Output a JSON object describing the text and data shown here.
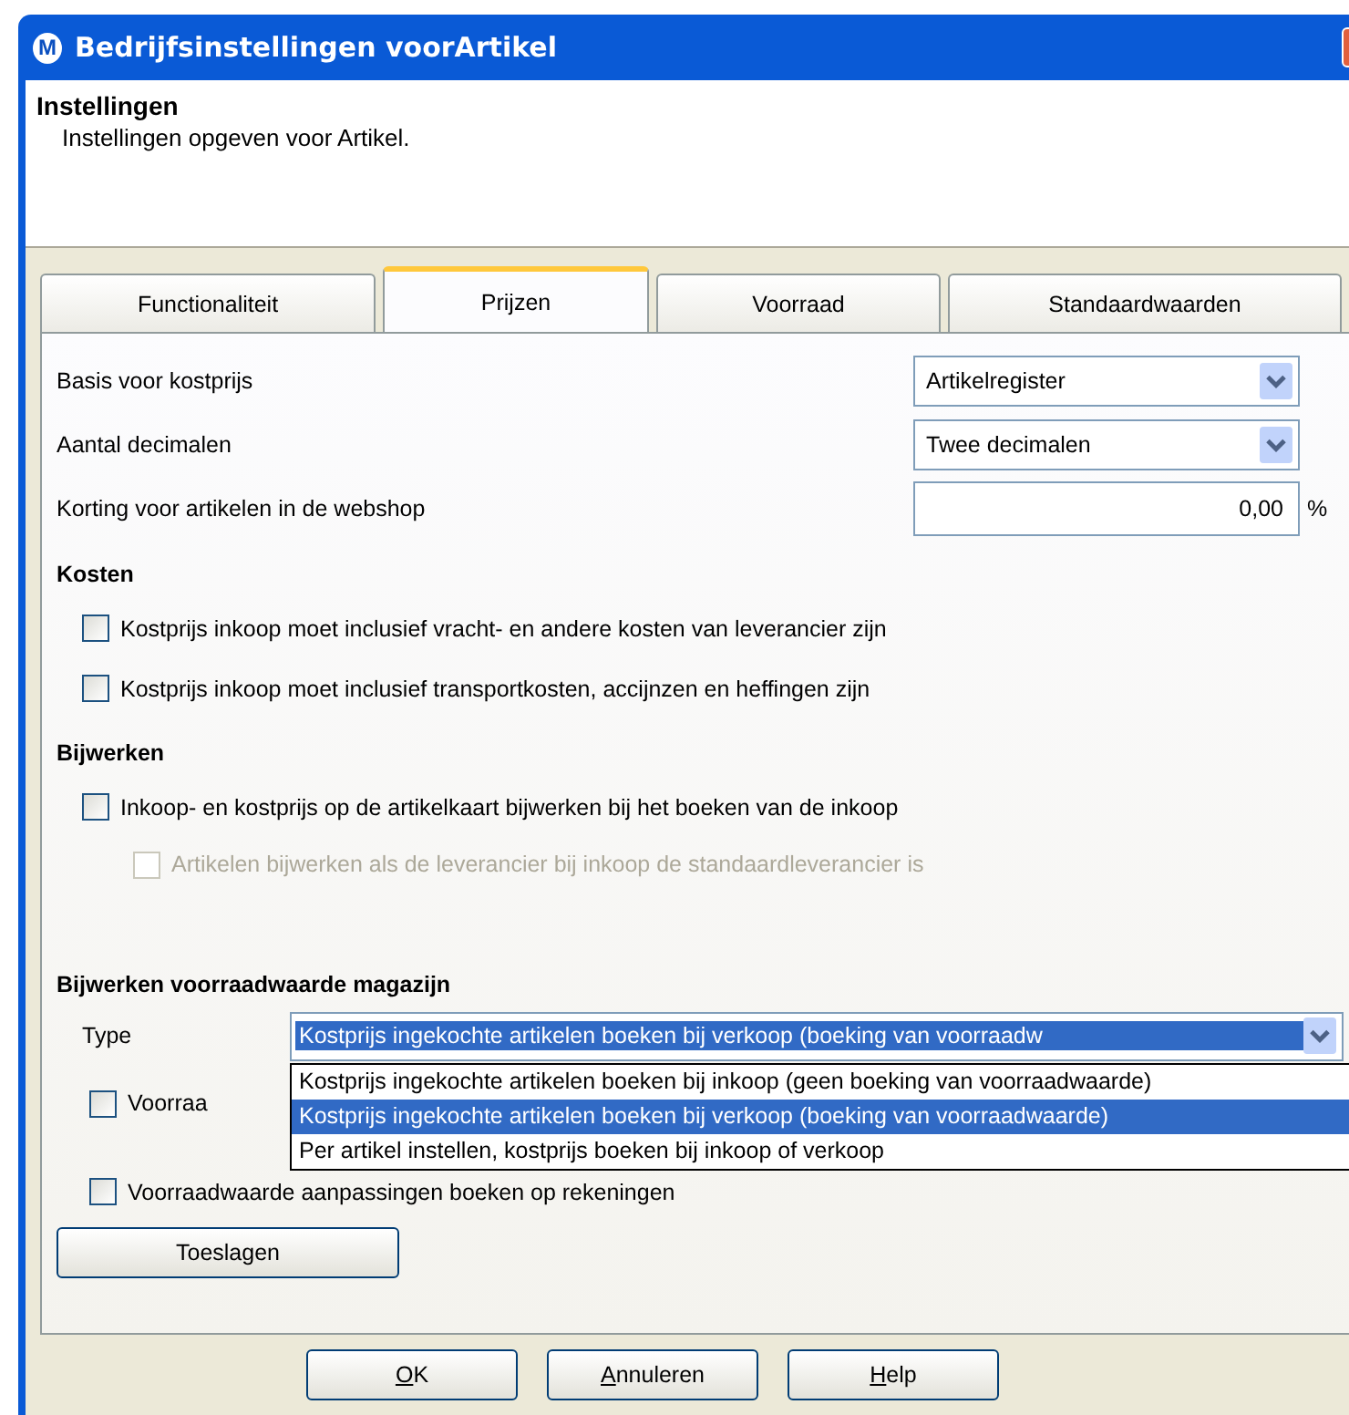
{
  "window": {
    "title": "Bedrijfsinstellingen voorArtikel",
    "app_icon": "M"
  },
  "header": {
    "title": "Instellingen",
    "subtitle": "Instellingen opgeven voor Artikel."
  },
  "tabs": [
    {
      "label": "Functionaliteit",
      "selected": false
    },
    {
      "label": "Prijzen",
      "selected": true
    },
    {
      "label": "Voorraad",
      "selected": false
    },
    {
      "label": "Standaardwaarden",
      "selected": false
    }
  ],
  "fields": [
    {
      "kind": "select",
      "label": "Basis voor kostprijs",
      "value": "Artikelregister"
    },
    {
      "kind": "select",
      "label": "Aantal decimalen",
      "value": "Twee decimalen"
    },
    {
      "kind": "number",
      "label": "Korting voor artikelen in de webshop",
      "value": "0,00",
      "unit": "%"
    }
  ],
  "sections": [
    {
      "title": "Kosten",
      "options": [
        {
          "label": "Kostprijs inkoop moet inclusief vracht- en andere kosten van leverancier zijn",
          "checked": false,
          "disabled": false
        },
        {
          "label": "Kostprijs inkoop moet inclusief transportkosten, accijnzen en heffingen zijn",
          "checked": false,
          "disabled": false
        }
      ]
    },
    {
      "title": "Bijwerken",
      "options": [
        {
          "label": "Inkoop- en kostprijs op de artikelkaart bijwerken bij het boeken van de inkoop",
          "checked": false,
          "disabled": false,
          "children": [
            {
              "label": "Artikelen bijwerken als de leverancier bij inkoop de standaardleverancier is",
              "checked": false,
              "disabled": true
            }
          ]
        }
      ]
    }
  ],
  "stock": {
    "title": "Bijwerken voorraadwaarde magazijn",
    "type_label": "Type",
    "type_value": "Kostprijs ingekochte artikelen boeken bij verkoop (boeking van voorraadw",
    "expanded": true,
    "dropdown_options": [
      {
        "label": "Kostprijs ingekochte artikelen boeken bij inkoop (geen boeking van voorraadwaarde)",
        "selected": false
      },
      {
        "label": "Kostprijs ingekochte artikelen boeken bij verkoop (boeking van voorraadwaarde)",
        "selected": true
      },
      {
        "label": "Per artikel instellen, kostprijs boeken bij inkoop of verkoop",
        "selected": false
      }
    ],
    "options": [
      {
        "label": "Voorraa",
        "checked": false
      },
      {
        "label": "Voorraadwaarde aanpassingen boeken op rekeningen",
        "checked": false
      }
    ]
  },
  "side_button": "Toeslagen",
  "buttons": [
    {
      "mnemonic": "O",
      "rest": "K"
    },
    {
      "mnemonic": "A",
      "rest": "nnuleren"
    },
    {
      "mnemonic": "H",
      "rest": "elp"
    }
  ]
}
